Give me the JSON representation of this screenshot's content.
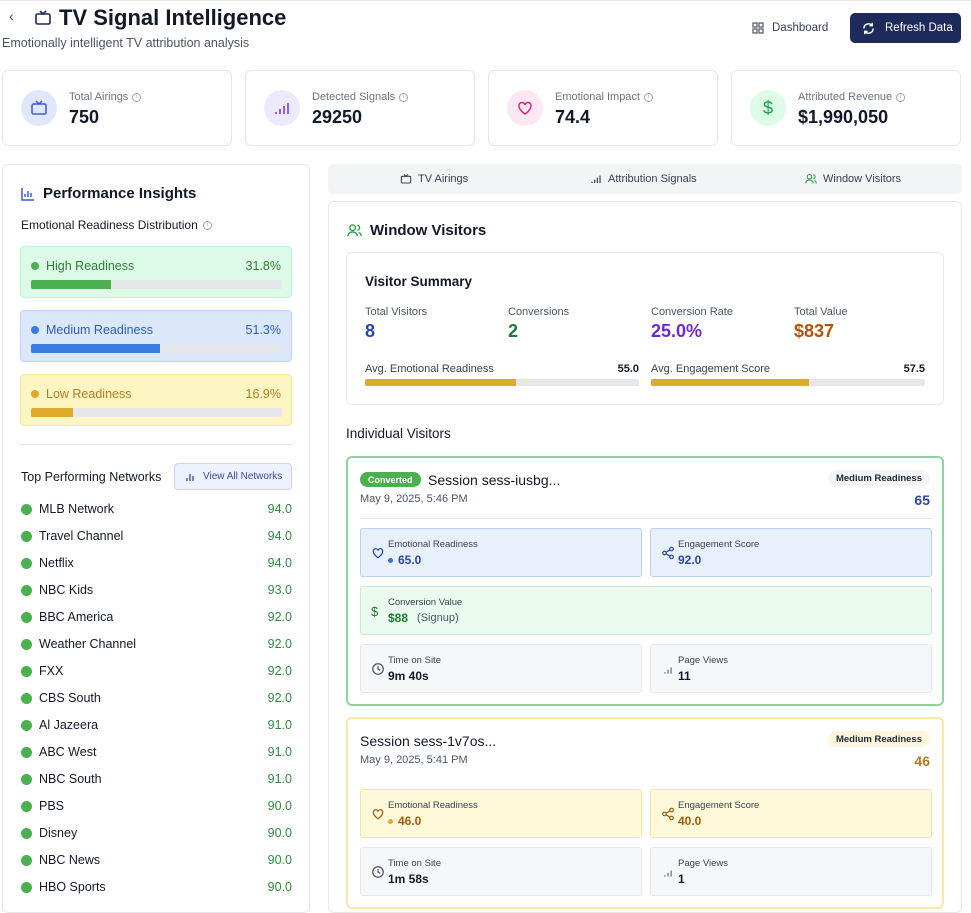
{
  "header": {
    "back_icon": "chevron-left-icon",
    "title": "TV Signal Intelligence",
    "subtitle": "Emotionally intelligent TV attribution analysis",
    "dashboard_label": "Dashboard",
    "refresh_label": "Refresh Data"
  },
  "stats": [
    {
      "label": "Total Airings",
      "value": "750",
      "icon": "tv-icon",
      "color": "#3b5bdb"
    },
    {
      "label": "Detected Signals",
      "value": "29250",
      "icon": "signal-icon",
      "color": "#7c3aed"
    },
    {
      "label": "Emotional Impact",
      "value": "74.4",
      "icon": "heart-icon",
      "color": "#db2777"
    },
    {
      "label": "Attributed Revenue",
      "value": "$1,990,050",
      "icon": "dollar-icon",
      "color": "#16a34a"
    }
  ],
  "insights": {
    "title": "Performance Insights",
    "distribution_title": "Emotional Readiness Distribution",
    "readiness": [
      {
        "name": "High Readiness",
        "percent": "31.8%",
        "fraction": 0.318
      },
      {
        "name": "Medium Readiness",
        "percent": "51.3%",
        "fraction": 0.513
      },
      {
        "name": "Low Readiness",
        "percent": "16.9%",
        "fraction": 0.169
      }
    ],
    "networks_title": "Top Performing Networks",
    "view_all_label": "View All Networks",
    "networks": [
      {
        "name": "MLB Network",
        "score": "94.0"
      },
      {
        "name": "Travel Channel",
        "score": "94.0"
      },
      {
        "name": "Netflix",
        "score": "94.0"
      },
      {
        "name": "NBC Kids",
        "score": "93.0"
      },
      {
        "name": "BBC America",
        "score": "92.0"
      },
      {
        "name": "Weather Channel",
        "score": "92.0"
      },
      {
        "name": "FXX",
        "score": "92.0"
      },
      {
        "name": "CBS South",
        "score": "92.0"
      },
      {
        "name": "Al Jazeera",
        "score": "91.0"
      },
      {
        "name": "ABC West",
        "score": "91.0"
      },
      {
        "name": "NBC South",
        "score": "91.0"
      },
      {
        "name": "PBS",
        "score": "90.0"
      },
      {
        "name": "Disney",
        "score": "90.0"
      },
      {
        "name": "NBC News",
        "score": "90.0"
      },
      {
        "name": "HBO Sports",
        "score": "90.0"
      }
    ]
  },
  "tabs": [
    {
      "label": "TV Airings",
      "icon": "tv-icon"
    },
    {
      "label": "Attribution Signals",
      "icon": "signal-icon"
    },
    {
      "label": "Window Visitors",
      "icon": "users-icon"
    }
  ],
  "window_visitors": {
    "title": "Window Visitors",
    "summary": {
      "title": "Visitor Summary",
      "total_visitors_label": "Total Visitors",
      "total_visitors": "8",
      "conversions_label": "Conversions",
      "conversions": "2",
      "conversion_rate_label": "Conversion Rate",
      "conversion_rate": "25.0%",
      "total_value_label": "Total Value",
      "total_value": "$837",
      "avg_readiness_label": "Avg. Emotional Readiness",
      "avg_readiness": "55.0",
      "avg_readiness_fraction": 0.55,
      "avg_engagement_label": "Avg. Engagement Score",
      "avg_engagement": "57.5",
      "avg_engagement_fraction": 0.575
    },
    "individual_title": "Individual Visitors",
    "visitors": [
      {
        "converted_label": "Converted",
        "session": "Session sess-iusbg...",
        "date": "May 9, 2025, 5:46 PM",
        "badge": "Medium Readiness",
        "score": "65",
        "emotional_label": "Emotional Readiness",
        "emotional_value": "65.0",
        "engagement_label": "Engagement Score",
        "engagement_value": "92.0",
        "conversion_label": "Conversion Value",
        "conversion_value": "$88",
        "conversion_type": "(Signup)",
        "time_label": "Time on Site",
        "time_value": "9m 40s",
        "pages_label": "Page Views",
        "pages_value": "11"
      },
      {
        "session": "Session sess-1v7os...",
        "date": "May 9, 2025, 5:41 PM",
        "badge": "Medium Readiness",
        "score": "46",
        "emotional_label": "Emotional Readiness",
        "emotional_value": "46.0",
        "engagement_label": "Engagement Score",
        "engagement_value": "40.0",
        "time_label": "Time on Site",
        "time_value": "1m 58s",
        "pages_label": "Page Views",
        "pages_value": "1"
      }
    ]
  },
  "colors": {
    "navy": "#1e2a5a",
    "green": "#2e8b3e",
    "blue": "#3b5bdb",
    "purple": "#6d28d9",
    "amber": "#b45309"
  }
}
